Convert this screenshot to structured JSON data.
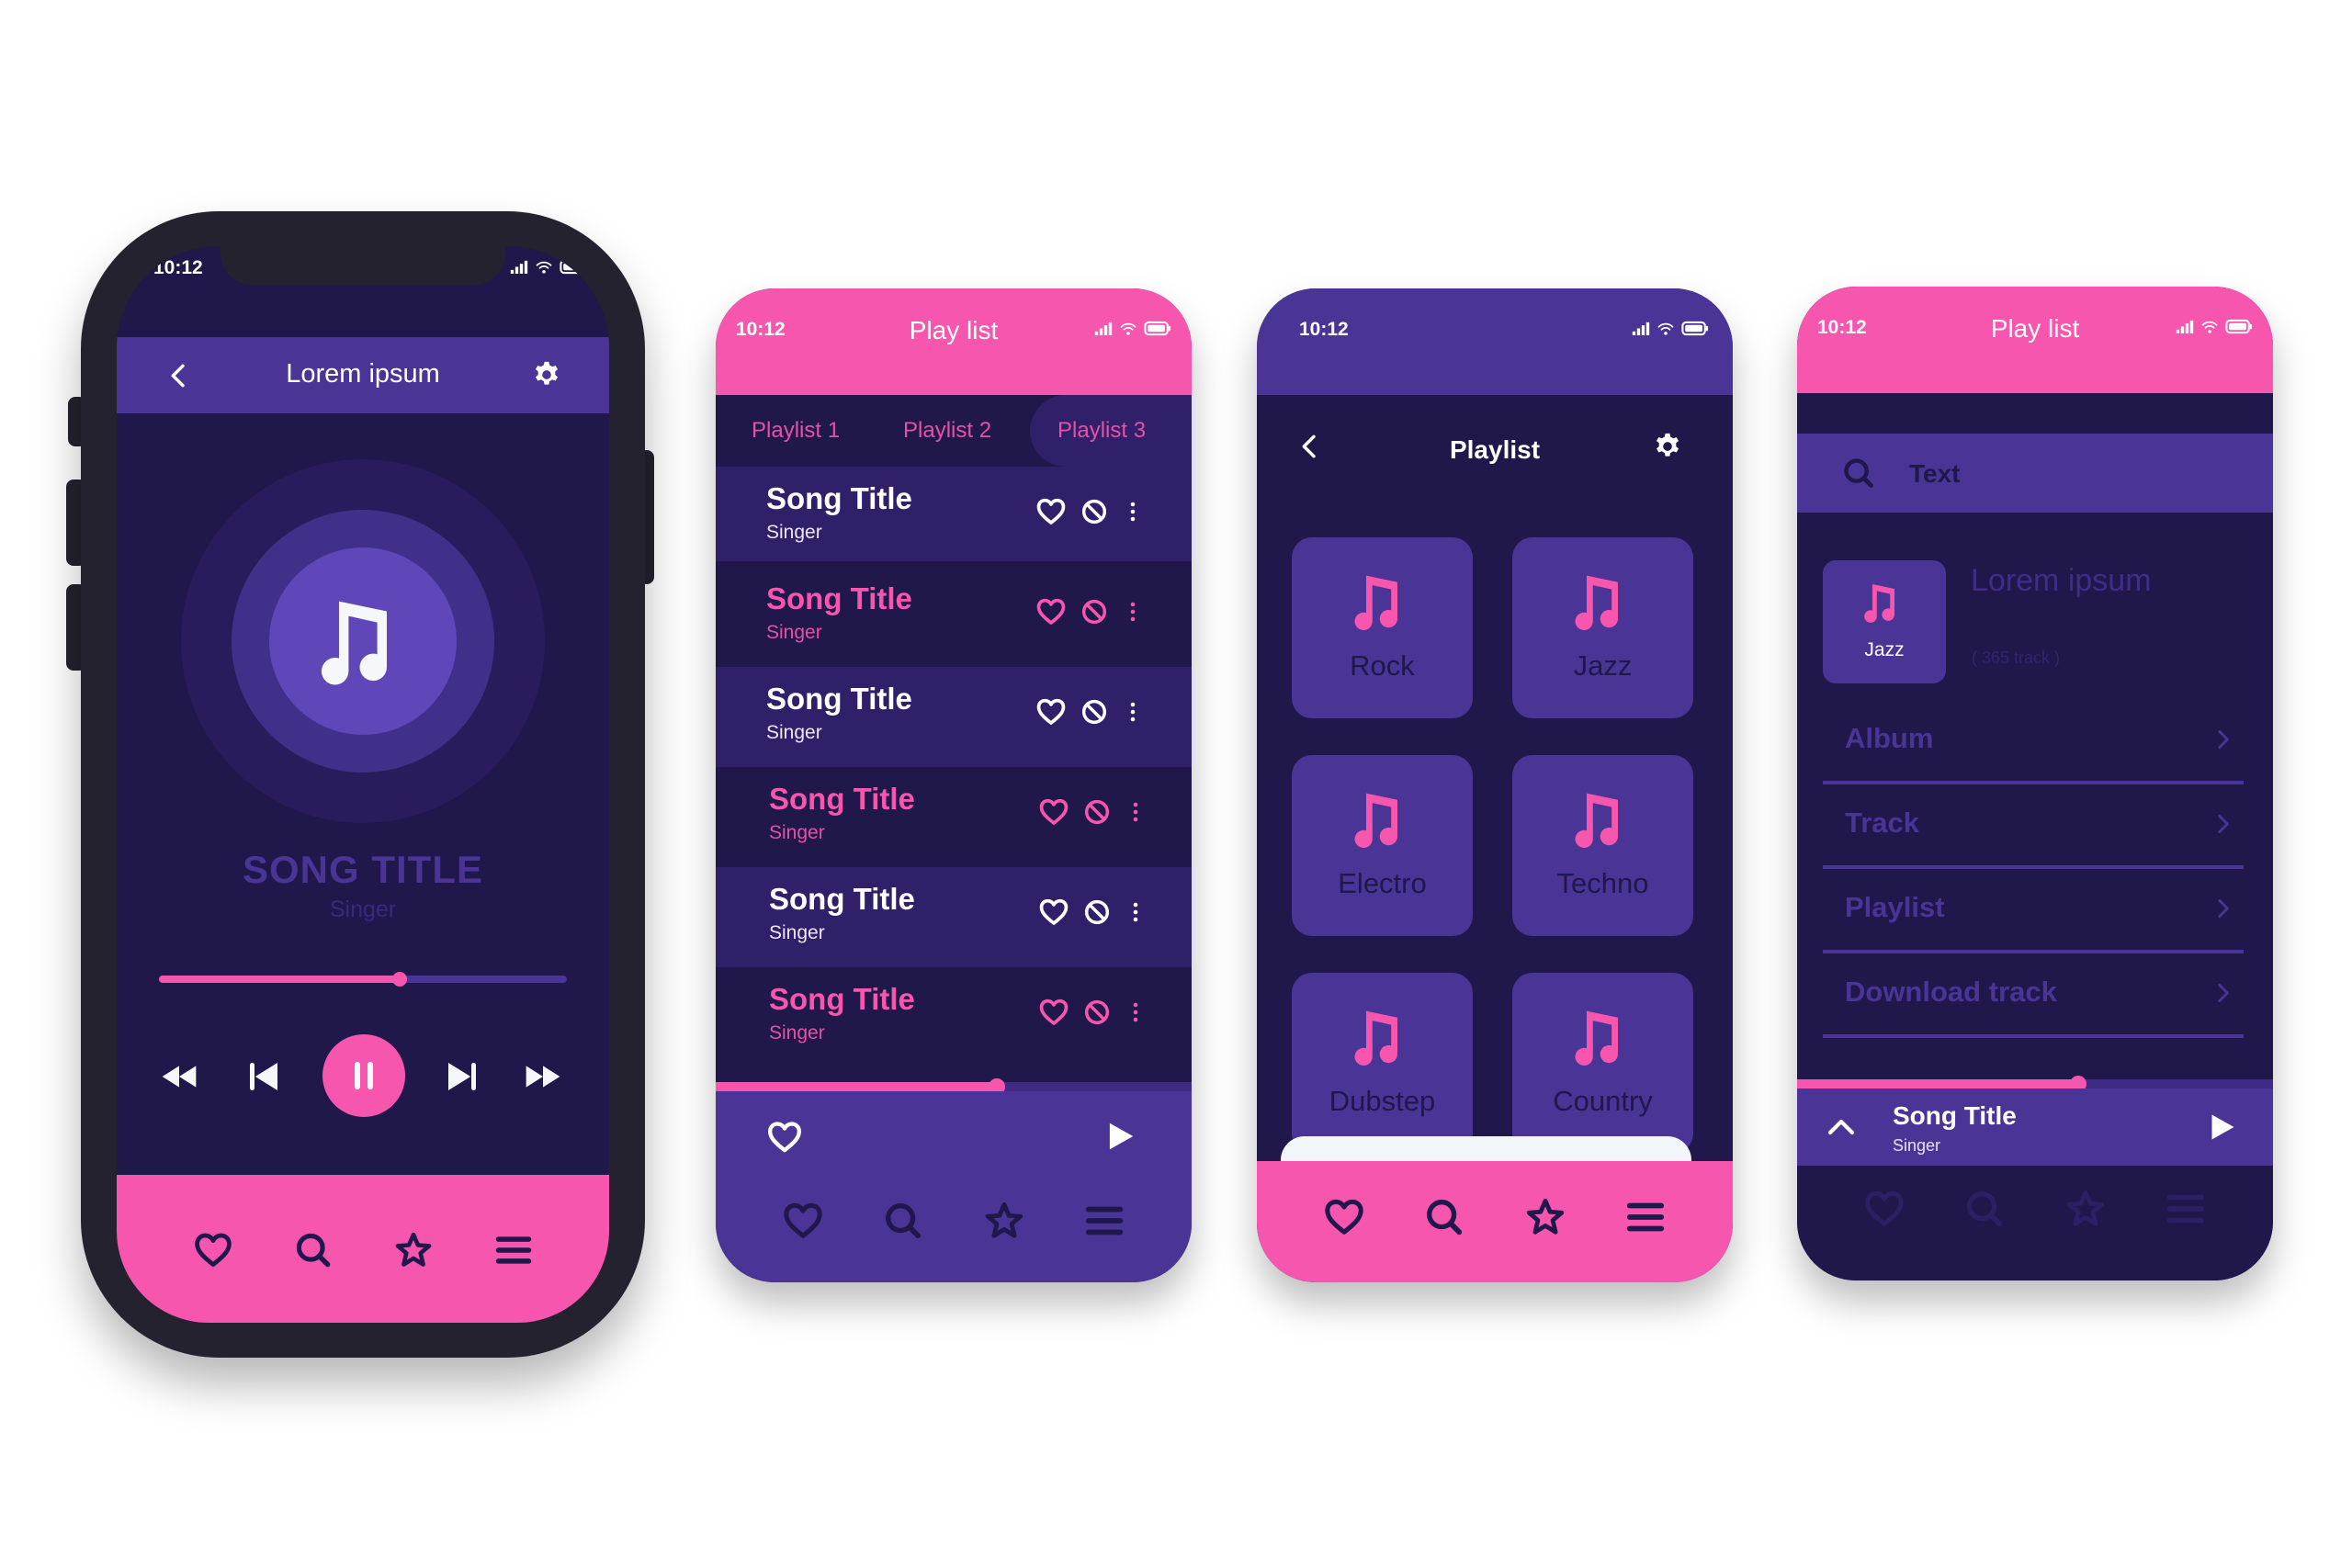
{
  "colors": {
    "pink": "#f656ae",
    "purple": "#4a3496",
    "dark": "#20174a",
    "device": "#23222e",
    "white": "#ffffff"
  },
  "status_bar": {
    "time": "10:12",
    "icons": [
      "signal-icon",
      "wifi-icon",
      "battery-icon"
    ]
  },
  "player": {
    "header_title": "Lorem ipsum",
    "back_icon": "chevron-left-icon",
    "settings_icon": "gear-icon",
    "album_art_icon": "music-note-icon",
    "song_title": "SONG TITLE",
    "singer": "Singer",
    "progress": 0.59,
    "controls": [
      "rewind-icon",
      "previous-icon",
      "pause-icon",
      "next-icon",
      "fast-forward-icon"
    ],
    "bottom_nav": [
      "heart-icon",
      "search-icon",
      "star-icon",
      "menu-icon"
    ]
  },
  "playlist_screen": {
    "header_title": "Play list",
    "tabs": [
      {
        "label": "Playlist 1",
        "active": false
      },
      {
        "label": "Playlist 2",
        "active": false
      },
      {
        "label": "Playlist 3",
        "active": true
      }
    ],
    "songs": [
      {
        "title": "Song Title",
        "singer": "Singer",
        "highlighted": false
      },
      {
        "title": "Song Title",
        "singer": "Singer",
        "highlighted": true
      },
      {
        "title": "Song Title",
        "singer": "Singer",
        "highlighted": false
      },
      {
        "title": "Song Title",
        "singer": "Singer",
        "highlighted": true
      },
      {
        "title": "Song Title",
        "singer": "Singer",
        "highlighted": false
      },
      {
        "title": "Song Title",
        "singer": "Singer",
        "highlighted": true
      }
    ],
    "row_actions": [
      "heart-icon",
      "block-icon",
      "more-vertical-icon"
    ],
    "progress": 0.59,
    "mini_player": {
      "like_icon": "heart-icon",
      "play_icon": "play-icon"
    },
    "bottom_nav": [
      "heart-icon",
      "search-icon",
      "star-icon",
      "menu-icon"
    ]
  },
  "genre_screen": {
    "title": "Playlist",
    "back_icon": "chevron-left-icon",
    "settings_icon": "gear-icon",
    "genres": [
      "Rock",
      "Jazz",
      "Electro",
      "Techno",
      "Dubstep",
      "Country"
    ],
    "bottom_nav": [
      "heart-icon",
      "search-icon",
      "star-icon",
      "menu-icon"
    ]
  },
  "library_screen": {
    "header_title": "Play list",
    "search_placeholder": "Text",
    "featured": {
      "card_label": "Jazz",
      "title": "Lorem ipsum",
      "tracks": "( 365 track )"
    },
    "menu": [
      "Album",
      "Track",
      "Playlist",
      "Download track"
    ],
    "progress": 0.59,
    "now_playing": {
      "title": "Song Title",
      "singer": "Singer"
    },
    "bottom_nav": [
      "heart-icon",
      "search-icon",
      "star-icon",
      "menu-icon"
    ]
  }
}
